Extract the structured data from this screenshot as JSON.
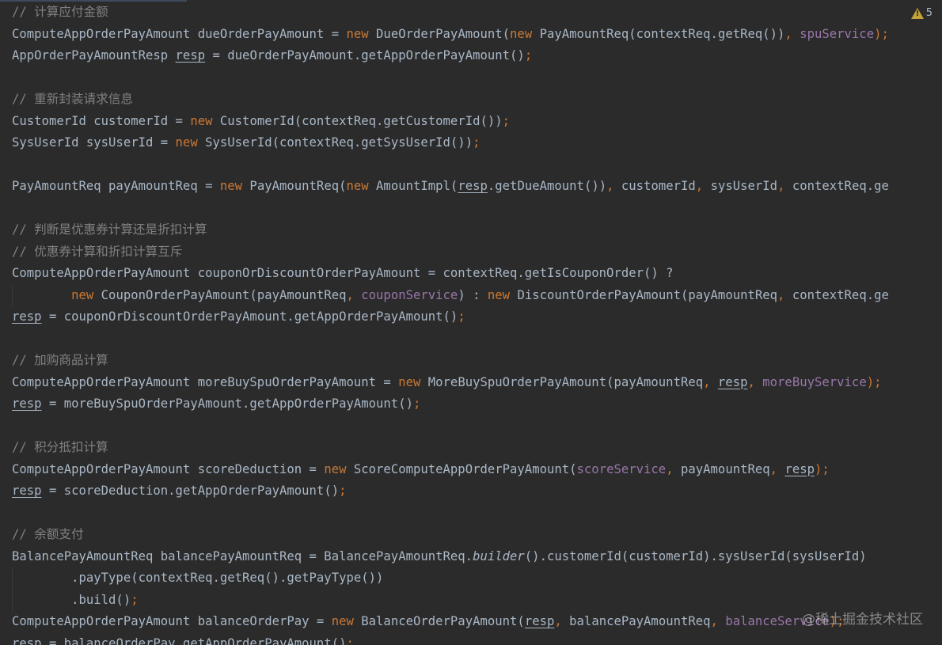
{
  "inspection": {
    "icon": "warning-icon",
    "count": "5",
    "color": "#c4a33a"
  },
  "colors": {
    "background": "#2b2b2b",
    "text": "#a9b7c6",
    "keyword": "#cc7832",
    "comment": "#808080",
    "field": "#9876aa"
  },
  "code": {
    "lines": [
      {
        "tokens": [
          {
            "t": "// 计算应付金额",
            "c": "comment"
          }
        ]
      },
      {
        "tokens": [
          {
            "t": "ComputeAppOrderPayAmount dueOrderPayAmount = "
          },
          {
            "t": "new",
            "c": "kw"
          },
          {
            "t": " DueOrderPayAmount("
          },
          {
            "t": "new",
            "c": "kw"
          },
          {
            "t": " PayAmountReq(contextReq.getReq())"
          },
          {
            "t": ", ",
            "c": "punct"
          },
          {
            "t": "spuService",
            "c": "field"
          },
          {
            "t": ");",
            "c": "punct"
          }
        ]
      },
      {
        "tokens": [
          {
            "t": "AppOrderPayAmountResp "
          },
          {
            "t": "resp",
            "c": "under"
          },
          {
            "t": " = dueOrderPayAmount.getAppOrderPayAmount()"
          },
          {
            "t": ";",
            "c": "punct"
          }
        ]
      },
      {
        "tokens": []
      },
      {
        "tokens": [
          {
            "t": "// 重新封装请求信息",
            "c": "comment"
          }
        ]
      },
      {
        "tokens": [
          {
            "t": "CustomerId customerId = "
          },
          {
            "t": "new",
            "c": "kw"
          },
          {
            "t": " CustomerId(contextReq.getCustomerId())"
          },
          {
            "t": ";",
            "c": "punct"
          }
        ]
      },
      {
        "tokens": [
          {
            "t": "SysUserId sysUserId = "
          },
          {
            "t": "new",
            "c": "kw"
          },
          {
            "t": " SysUserId(contextReq.getSysUserId())"
          },
          {
            "t": ";",
            "c": "punct"
          }
        ]
      },
      {
        "tokens": []
      },
      {
        "tokens": [
          {
            "t": "PayAmountReq payAmountReq = "
          },
          {
            "t": "new",
            "c": "kw"
          },
          {
            "t": " PayAmountReq("
          },
          {
            "t": "new",
            "c": "kw"
          },
          {
            "t": " AmountImpl("
          },
          {
            "t": "resp",
            "c": "under"
          },
          {
            "t": ".getDueAmount())"
          },
          {
            "t": ", ",
            "c": "punct"
          },
          {
            "t": "customerId"
          },
          {
            "t": ", ",
            "c": "punct"
          },
          {
            "t": "sysUserId"
          },
          {
            "t": ", ",
            "c": "punct"
          },
          {
            "t": "contextReq.ge"
          }
        ]
      },
      {
        "tokens": []
      },
      {
        "tokens": [
          {
            "t": "// 判断是优惠券计算还是折扣计算",
            "c": "comment"
          }
        ]
      },
      {
        "tokens": [
          {
            "t": "// 优惠券计算和折扣计算互斥",
            "c": "comment"
          }
        ]
      },
      {
        "tokens": [
          {
            "t": "ComputeAppOrderPayAmount couponOrDiscountOrderPayAmount = contextReq.getIsCouponOrder() ?"
          }
        ]
      },
      {
        "tokens": [
          {
            "t": "        "
          },
          {
            "t": "new",
            "c": "kw"
          },
          {
            "t": " CouponOrderPayAmount(payAmountReq"
          },
          {
            "t": ", ",
            "c": "punct"
          },
          {
            "t": "couponService",
            "c": "field"
          },
          {
            "t": ") : "
          },
          {
            "t": "new",
            "c": "kw"
          },
          {
            "t": " DiscountOrderPayAmount(payAmountReq"
          },
          {
            "t": ", ",
            "c": "punct"
          },
          {
            "t": "contextReq.ge"
          }
        ]
      },
      {
        "tokens": [
          {
            "t": "resp",
            "c": "under"
          },
          {
            "t": " = couponOrDiscountOrderPayAmount.getAppOrderPayAmount()"
          },
          {
            "t": ";",
            "c": "punct"
          }
        ]
      },
      {
        "tokens": []
      },
      {
        "tokens": [
          {
            "t": "// 加购商品计算",
            "c": "comment"
          }
        ]
      },
      {
        "tokens": [
          {
            "t": "ComputeAppOrderPayAmount moreBuySpuOrderPayAmount = "
          },
          {
            "t": "new",
            "c": "kw"
          },
          {
            "t": " MoreBuySpuOrderPayAmount(payAmountReq"
          },
          {
            "t": ", ",
            "c": "punct"
          },
          {
            "t": "resp",
            "c": "under"
          },
          {
            "t": ", ",
            "c": "punct"
          },
          {
            "t": "moreBuyService",
            "c": "field"
          },
          {
            "t": ");",
            "c": "punct"
          }
        ]
      },
      {
        "tokens": [
          {
            "t": "resp",
            "c": "under"
          },
          {
            "t": " = moreBuySpuOrderPayAmount.getAppOrderPayAmount()"
          },
          {
            "t": ";",
            "c": "punct"
          }
        ]
      },
      {
        "tokens": []
      },
      {
        "tokens": [
          {
            "t": "// 积分抵扣计算",
            "c": "comment"
          }
        ]
      },
      {
        "tokens": [
          {
            "t": "ComputeAppOrderPayAmount scoreDeduction = "
          },
          {
            "t": "new",
            "c": "kw"
          },
          {
            "t": " ScoreComputeAppOrderPayAmount("
          },
          {
            "t": "scoreService",
            "c": "field"
          },
          {
            "t": ", ",
            "c": "punct"
          },
          {
            "t": "payAmountReq"
          },
          {
            "t": ", ",
            "c": "punct"
          },
          {
            "t": "resp",
            "c": "under"
          },
          {
            "t": ");",
            "c": "punct"
          }
        ]
      },
      {
        "tokens": [
          {
            "t": "resp",
            "c": "under"
          },
          {
            "t": " = scoreDeduction.getAppOrderPayAmount()"
          },
          {
            "t": ";",
            "c": "punct"
          }
        ]
      },
      {
        "tokens": []
      },
      {
        "tokens": [
          {
            "t": "// 余额支付",
            "c": "comment"
          }
        ]
      },
      {
        "tokens": [
          {
            "t": "BalancePayAmountReq balancePayAmountReq = BalancePayAmountReq."
          },
          {
            "t": "builder",
            "c": "ital"
          },
          {
            "t": "().customerId(customerId).sysUserId(sysUserId)"
          }
        ]
      },
      {
        "tokens": [
          {
            "t": "        .payType(contextReq.getReq().getPayType())"
          }
        ]
      },
      {
        "tokens": [
          {
            "t": "        .build()"
          },
          {
            "t": ";",
            "c": "punct"
          }
        ]
      },
      {
        "tokens": [
          {
            "t": "ComputeAppOrderPayAmount balanceOrderPay = "
          },
          {
            "t": "new",
            "c": "kw"
          },
          {
            "t": " BalanceOrderPayAmount("
          },
          {
            "t": "resp",
            "c": "under"
          },
          {
            "t": ", ",
            "c": "punct"
          },
          {
            "t": "balancePayAmountReq"
          },
          {
            "t": ", ",
            "c": "punct"
          },
          {
            "t": "balanceService",
            "c": "field"
          },
          {
            "t": ");",
            "c": "punct"
          }
        ]
      },
      {
        "tokens": [
          {
            "t": "resp",
            "c": "under"
          },
          {
            "t": " = balanceOrderPay.getAppOrderPayAmount()"
          },
          {
            "t": ";",
            "c": "punct"
          }
        ]
      }
    ]
  },
  "watermark": {
    "text": "@稀土掘金技术社区"
  }
}
